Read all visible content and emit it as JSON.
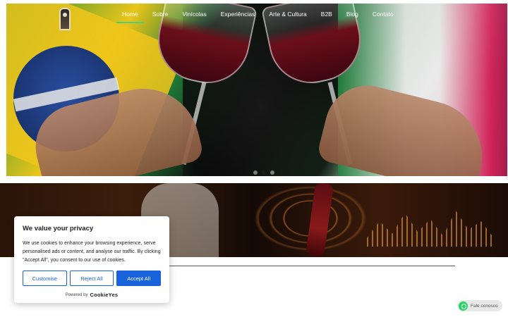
{
  "nav": {
    "items": [
      "Home",
      "Sobre",
      "Vinícolas",
      "Experiências",
      "Arte & Cultura",
      "B2B",
      "Blog",
      "Contato"
    ],
    "active": "Home"
  },
  "hero": {
    "slide_count": 3,
    "active_slide": 2
  },
  "cookie": {
    "title": "We value your privacy",
    "text": "We use cookies to enhance your browsing experience, serve personalised ads or content, and analyse our traffic. By clicking \"Accept All\", you consent to our use of cookies.",
    "customise": "Customise",
    "reject": "Reject All",
    "accept": "Accept All",
    "powered_by": "Powered by",
    "brand": "CookieYes",
    "colors": {
      "primary": "#1863dc"
    }
  },
  "whatsapp": {
    "label": "Fale conosco",
    "icon": "whatsapp-icon",
    "color": "#25d366"
  }
}
